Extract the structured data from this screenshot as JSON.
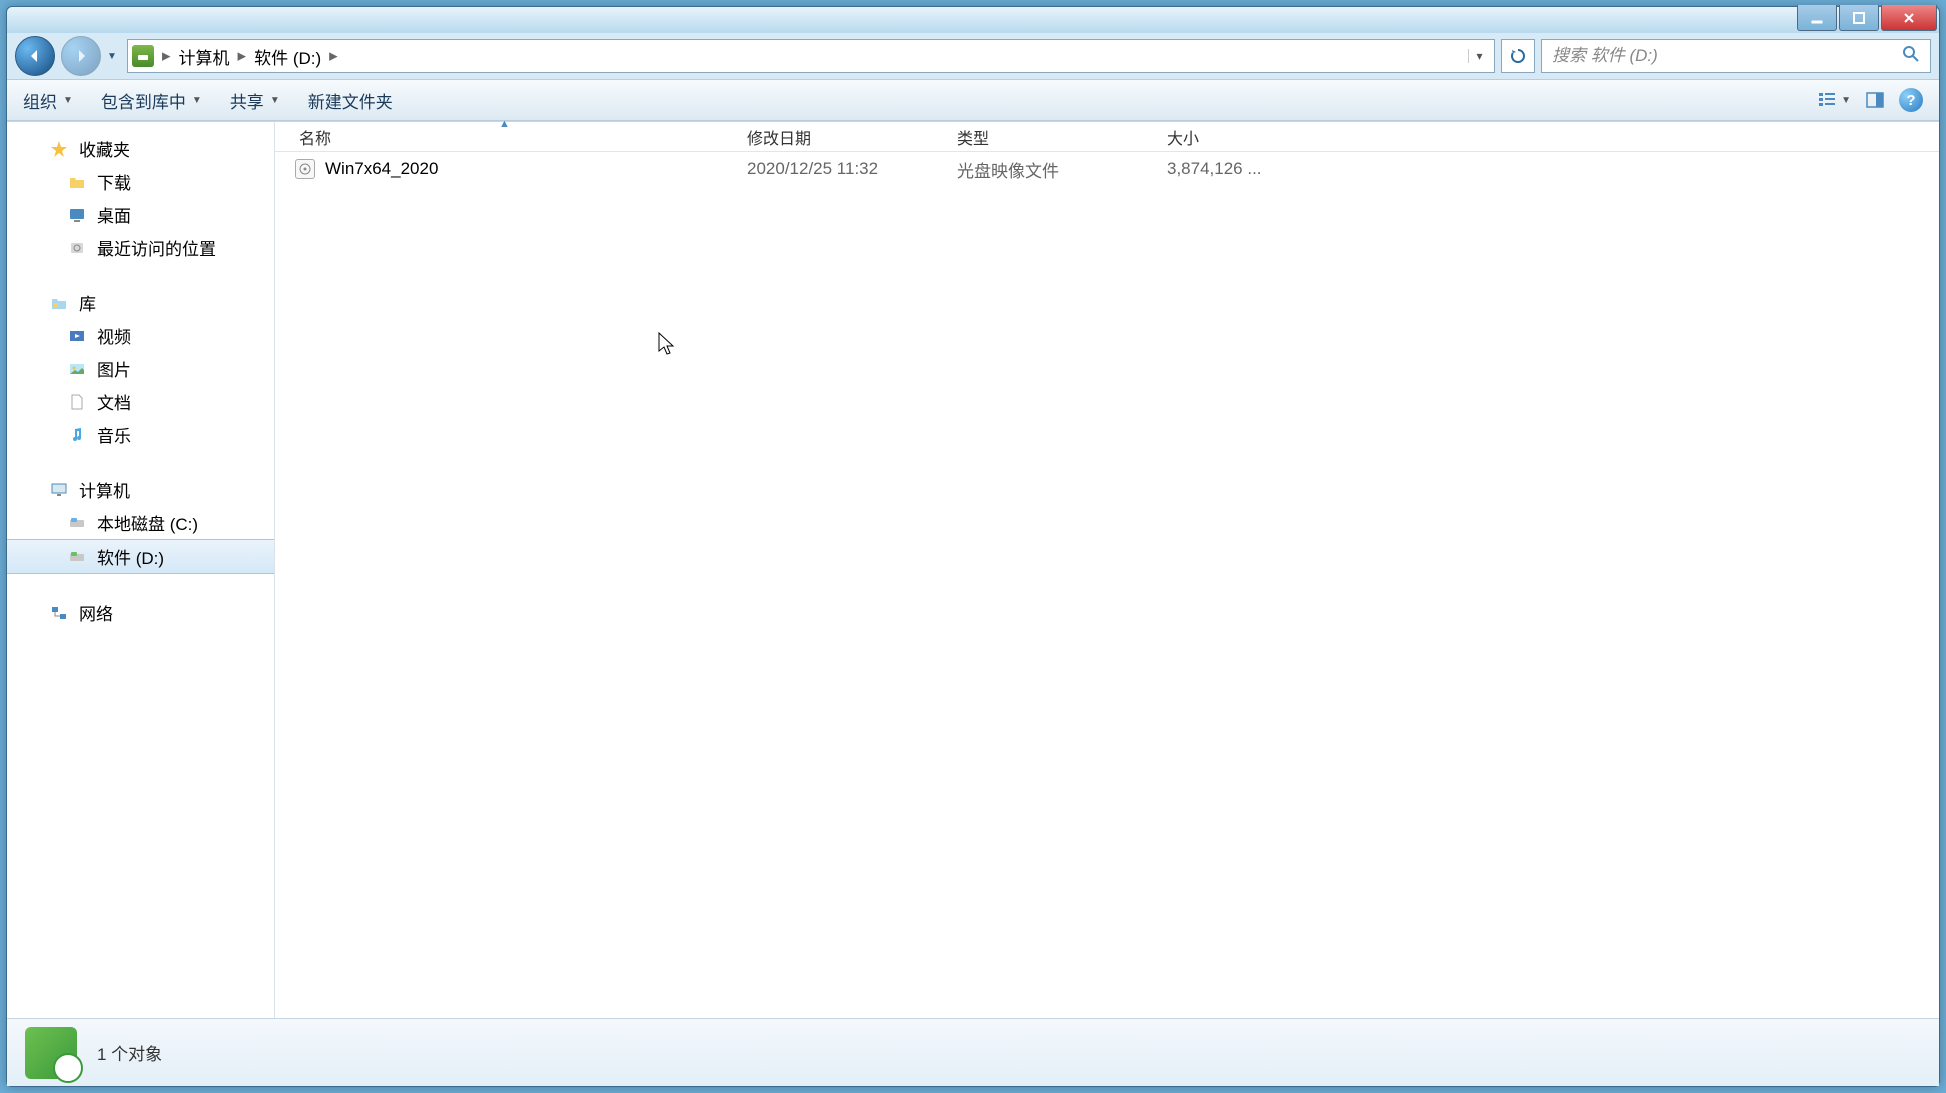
{
  "address": {
    "crumbs": [
      "计算机",
      "软件 (D:)"
    ]
  },
  "search": {
    "placeholder": "搜索 软件 (D:)"
  },
  "toolbar": {
    "organize": "组织",
    "include": "包含到库中",
    "share": "共享",
    "newfolder": "新建文件夹"
  },
  "columns": {
    "name": "名称",
    "date": "修改日期",
    "type": "类型",
    "size": "大小"
  },
  "files": [
    {
      "name": "Win7x64_2020",
      "date": "2020/12/25 11:32",
      "type": "光盘映像文件",
      "size": "3,874,126 ..."
    }
  ],
  "sidebar": {
    "favorites": "收藏夹",
    "fav_items": [
      "下载",
      "桌面",
      "最近访问的位置"
    ],
    "libraries": "库",
    "lib_items": [
      "视频",
      "图片",
      "文档",
      "音乐"
    ],
    "computer": "计算机",
    "comp_items": [
      "本地磁盘 (C:)",
      "软件 (D:)"
    ],
    "network": "网络"
  },
  "status": {
    "count": "1 个对象"
  }
}
